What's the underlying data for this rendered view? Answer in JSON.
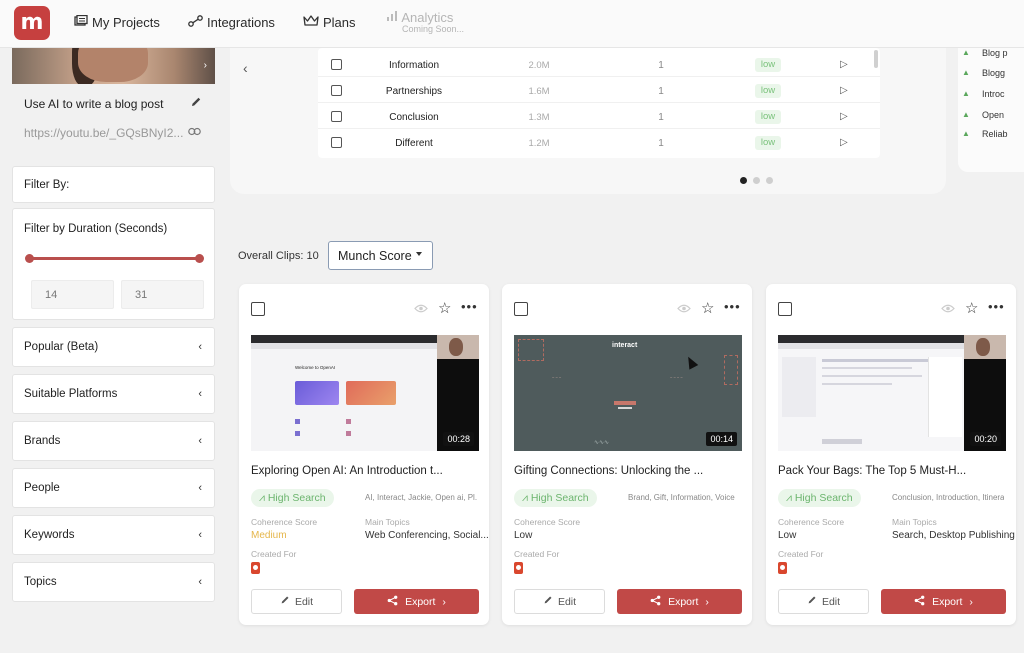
{
  "nav": {
    "logo": "m",
    "items": [
      {
        "label": "My Projects",
        "icon": "projects-icon"
      },
      {
        "label": "Integrations",
        "icon": "integrations-icon"
      },
      {
        "label": "Plans",
        "icon": "crown-icon"
      }
    ],
    "analytics": {
      "label": "Analytics",
      "sub": "Coming Soon..."
    }
  },
  "sidebar": {
    "video_title": "Use AI to write a blog post",
    "video_url": "https://youtu.be/_GQsBNyI2...",
    "filter_by": "Filter By:",
    "duration": {
      "title": "Filter by Duration (Seconds)",
      "min": "14",
      "max": "31",
      "range_fraction": [
        0,
        1
      ]
    },
    "filters": [
      "Popular (Beta)",
      "Suitable Platforms",
      "Brands",
      "People",
      "Keywords",
      "Topics"
    ]
  },
  "keyword_table": {
    "rows": [
      {
        "keyword": "Information",
        "volume": "2.0M",
        "count": "1",
        "difficulty": "low"
      },
      {
        "keyword": "Partnerships",
        "volume": "1.6M",
        "count": "1",
        "difficulty": "low"
      },
      {
        "keyword": "Conclusion",
        "volume": "1.3M",
        "count": "1",
        "difficulty": "low"
      },
      {
        "keyword": "Different",
        "volume": "1.2M",
        "count": "1",
        "difficulty": "low"
      }
    ],
    "pages": 3,
    "active_page": 1
  },
  "outline": [
    "Blog p",
    "Blogg",
    "Introc",
    "Open",
    "Reliab"
  ],
  "clips": {
    "count_label": "Overall Clips: 10",
    "sort": "Munch Score"
  },
  "cards": [
    {
      "title": "Exploring Open AI: An Introduction t...",
      "duration": "00:28",
      "badge": "High Search",
      "tags": "AI, Interact, Jackie, Open ai, Pl...",
      "coherence_label": "Coherence Score",
      "coherence": "Medium",
      "topics_label": "Main Topics",
      "topics": "Web Conferencing, Social...",
      "created_label": "Created For",
      "edit": "Edit",
      "export": "Export",
      "slide_heading": "Welcome to OpenAI"
    },
    {
      "title": "Gifting Connections: Unlocking the ...",
      "duration": "00:14",
      "badge": "High Search",
      "tags": "Brand, Gift, Information, Voice",
      "coherence_label": "Coherence Score",
      "coherence": "Low",
      "topics_label": "",
      "topics": "",
      "created_label": "Created For",
      "edit": "Edit",
      "export": "Export",
      "slide_heading": "interact"
    },
    {
      "title": "Pack Your Bags: The Top 5 Must-H...",
      "duration": "00:20",
      "badge": "High Search",
      "tags": "Conclusion, Introduction, Itinera",
      "coherence_label": "Coherence Score",
      "coherence": "Low",
      "topics_label": "Main Topics",
      "topics": "Search, Desktop Publishing",
      "created_label": "Created For",
      "edit": "Edit",
      "export": "Export",
      "slide_heading": ""
    }
  ],
  "colors": {
    "brand": "#c6403f",
    "export": "#c14947",
    "badge_bg": "#eaf6ea",
    "badge_text": "#6cb56e",
    "medium": "#e5b64a"
  }
}
